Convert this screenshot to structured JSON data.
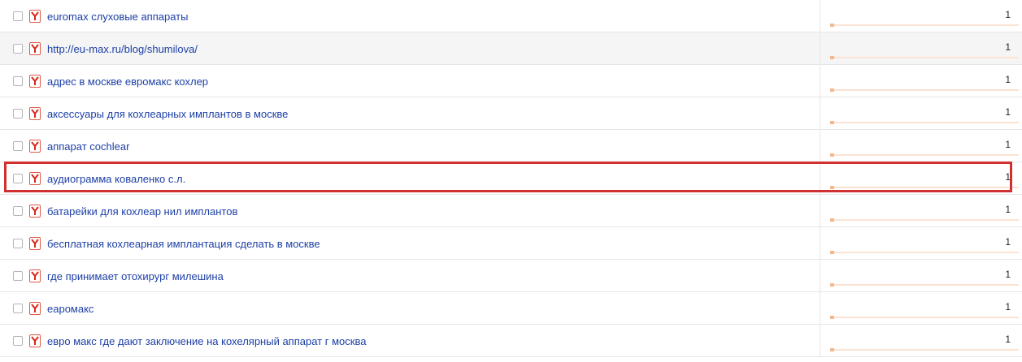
{
  "rows": [
    {
      "query": "euromax слуховые аппараты",
      "value": "1",
      "bar_fraction": 0.02
    },
    {
      "query": "http://eu-max.ru/blog/shumilova/",
      "value": "1",
      "bar_fraction": 0.02
    },
    {
      "query": "адрес в москве евромакс кохлер",
      "value": "1",
      "bar_fraction": 0.02
    },
    {
      "query": "аксессуары для кохлеарных имплантов в москве",
      "value": "1",
      "bar_fraction": 0.02
    },
    {
      "query": "аппарат cochlear",
      "value": "1",
      "bar_fraction": 0.02
    },
    {
      "query": "аудиограмма коваленко с.л.",
      "value": "1",
      "bar_fraction": 0.02
    },
    {
      "query": "батарейки для кохлеар нил имплантов",
      "value": "1",
      "bar_fraction": 0.02
    },
    {
      "query": "бесплатная кохлеарная имплантация сделать в москве",
      "value": "1",
      "bar_fraction": 0.02
    },
    {
      "query": "где принимает отохирург милешина",
      "value": "1",
      "bar_fraction": 0.02
    },
    {
      "query": "еаромакс",
      "value": "1",
      "bar_fraction": 0.02
    },
    {
      "query": "евро макс где дают заключение на кохелярный аппарат г москва",
      "value": "1",
      "bar_fraction": 0.02
    }
  ],
  "highlighted_row": 5,
  "icons": {
    "row_checkbox": "checkbox-icon",
    "source": "yandex-icon"
  },
  "colors": {
    "link": "#1c3fa6",
    "highlight": "#d03030",
    "bar_fill": "#f4b88a",
    "bar_track": "#fbe3d3"
  }
}
